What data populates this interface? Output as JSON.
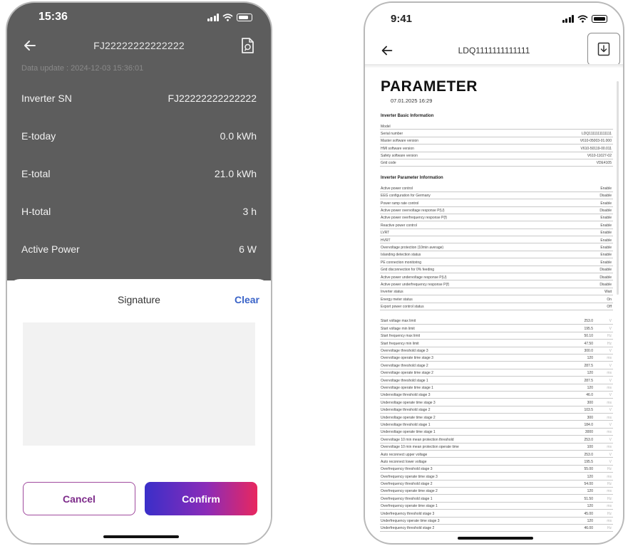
{
  "left_screen": {
    "status_time": "15:36",
    "nav_title": "FJ22222222222222",
    "data_update": "Data update : 2024-12-03 15:36:01",
    "rows": [
      {
        "label": "Inverter SN",
        "value": "FJ22222222222222"
      },
      {
        "label": "E-today",
        "value": "0.0 kWh"
      },
      {
        "label": "E-total",
        "value": "21.0 kWh"
      },
      {
        "label": "H-total",
        "value": "3 h"
      },
      {
        "label": "Active Power",
        "value": "6 W"
      }
    ],
    "sheet": {
      "title": "Signature",
      "clear_label": "Clear",
      "cancel_label": "Cancel",
      "confirm_label": "Confirm"
    }
  },
  "right_screen": {
    "status_time": "9:41",
    "nav_title": "LDQ1111111111111",
    "doc_title": "PARAMETER",
    "doc_date": "07.01.2025 16:29",
    "basic_info": {
      "title": "Inverter Basic Information",
      "rows": [
        {
          "name": "Model",
          "value": ""
        },
        {
          "name": "Serial number",
          "value": "LDQ1111111111111"
        },
        {
          "name": "Master software version",
          "value": "V610-05003-01.000"
        },
        {
          "name": "HMI software version",
          "value": "V610-50119-00.011"
        },
        {
          "name": "Safety software version",
          "value": "V610-11027-02"
        },
        {
          "name": "Grid code",
          "value": "VDE4105"
        }
      ]
    },
    "param_info": {
      "title": "Inverter Parameter Information",
      "rows": [
        {
          "name": "Active power control",
          "value": "Enable"
        },
        {
          "name": "EEG configuration for Germany",
          "value": "Disable"
        },
        {
          "name": "Power ramp rate control",
          "value": "Enable"
        },
        {
          "name": "Active power overvoltage response P(U)",
          "value": "Disable"
        },
        {
          "name": "Active power overfrequency response P(f)",
          "value": "Enable"
        },
        {
          "name": "Reactive power control",
          "value": "Enable"
        },
        {
          "name": "LVRT",
          "value": "Enable"
        },
        {
          "name": "HVRT",
          "value": "Enable"
        },
        {
          "name": "Overvoltage protection (10min average)",
          "value": "Enable"
        },
        {
          "name": "Islanding detection status",
          "value": "Enable"
        },
        {
          "name": "PE connection monitoring",
          "value": "Enable"
        },
        {
          "name": "Grid disconnection for 0% feeding",
          "value": "Disable"
        },
        {
          "name": "Active power undervoltage response P(U)",
          "value": "Disable"
        },
        {
          "name": "Active power underfrequency response P(f)",
          "value": "Disable"
        },
        {
          "name": "Inverter status",
          "value": "Wait"
        },
        {
          "name": "Energy meter status",
          "value": "On"
        },
        {
          "name": "Export power control status",
          "value": "Off"
        }
      ]
    },
    "limits": {
      "rows": [
        {
          "name": "Start voltage max limit",
          "value": "253.0",
          "unit": "V"
        },
        {
          "name": "Start voltage min limit",
          "value": "195.5",
          "unit": "V"
        },
        {
          "name": "Start frequency max limit",
          "value": "50.10",
          "unit": "Hz"
        },
        {
          "name": "Start frequency min limit",
          "value": "47.50",
          "unit": "Hz"
        },
        {
          "name": "Overvoltage threshold stage 3",
          "value": "300.0",
          "unit": "V"
        },
        {
          "name": "Overvoltage operate time stage 3",
          "value": "120",
          "unit": "ms"
        },
        {
          "name": "Overvoltage threshold stage 2",
          "value": "287.5",
          "unit": "V"
        },
        {
          "name": "Overvoltage operate time stage 2",
          "value": "120",
          "unit": "ms"
        },
        {
          "name": "Overvoltage threshold stage 1",
          "value": "287.5",
          "unit": "V"
        },
        {
          "name": "Overvoltage operate time stage 1",
          "value": "120",
          "unit": "ms"
        },
        {
          "name": "Undervoltage threshold stage 3",
          "value": "46.0",
          "unit": "V"
        },
        {
          "name": "Undervoltage operate time stage 3",
          "value": "300",
          "unit": "ms"
        },
        {
          "name": "Undervoltage threshold stage 2",
          "value": "103.5",
          "unit": "V"
        },
        {
          "name": "Undervoltage operate time stage 2",
          "value": "300",
          "unit": "ms"
        },
        {
          "name": "Undervoltage threshold stage 1",
          "value": "184.0",
          "unit": "V"
        },
        {
          "name": "Undervoltage operate time stage 1",
          "value": "3000",
          "unit": "ms"
        },
        {
          "name": "Overvoltage 10 min mean protection threshold",
          "value": "253.0",
          "unit": "V"
        },
        {
          "name": "Overvoltage 10 min mean protection operate time",
          "value": "100",
          "unit": "ms"
        },
        {
          "name": "Auto reconnect upper voltage",
          "value": "253.0",
          "unit": "V"
        },
        {
          "name": "Auto reconnect lower voltage",
          "value": "195.5",
          "unit": "V"
        },
        {
          "name": "Overfrequency threshold stage 3",
          "value": "55.00",
          "unit": "Hz"
        },
        {
          "name": "Overfrequency operate time stage 3",
          "value": "120",
          "unit": "ms"
        },
        {
          "name": "Overfrequency threshold stage 2",
          "value": "54.00",
          "unit": "Hz"
        },
        {
          "name": "Overfrequency operate time stage 2",
          "value": "120",
          "unit": "ms"
        },
        {
          "name": "Overfrequency threshold stage 1",
          "value": "51.50",
          "unit": "Hz"
        },
        {
          "name": "Overfrequency operate time stage 1",
          "value": "120",
          "unit": "ms"
        },
        {
          "name": "Underfrequency threshold stage 3",
          "value": "45.00",
          "unit": "Hz"
        },
        {
          "name": "Underfrequency operate time stage 3",
          "value": "120",
          "unit": "ms"
        },
        {
          "name": "Underfrequency threshold stage 2",
          "value": "46.00",
          "unit": "Hz"
        }
      ]
    }
  },
  "colors": {
    "dark_overlay": "#5d5d5d",
    "clear_link": "#3a63c8",
    "cancel_border": "#a04b9e",
    "confirm_gradient_start": "#3a2fc9",
    "confirm_gradient_end": "#e8275f"
  },
  "icons": [
    "back-arrow-icon",
    "document-icon",
    "signal-icon",
    "wifi-icon",
    "battery-icon",
    "download-icon"
  ]
}
